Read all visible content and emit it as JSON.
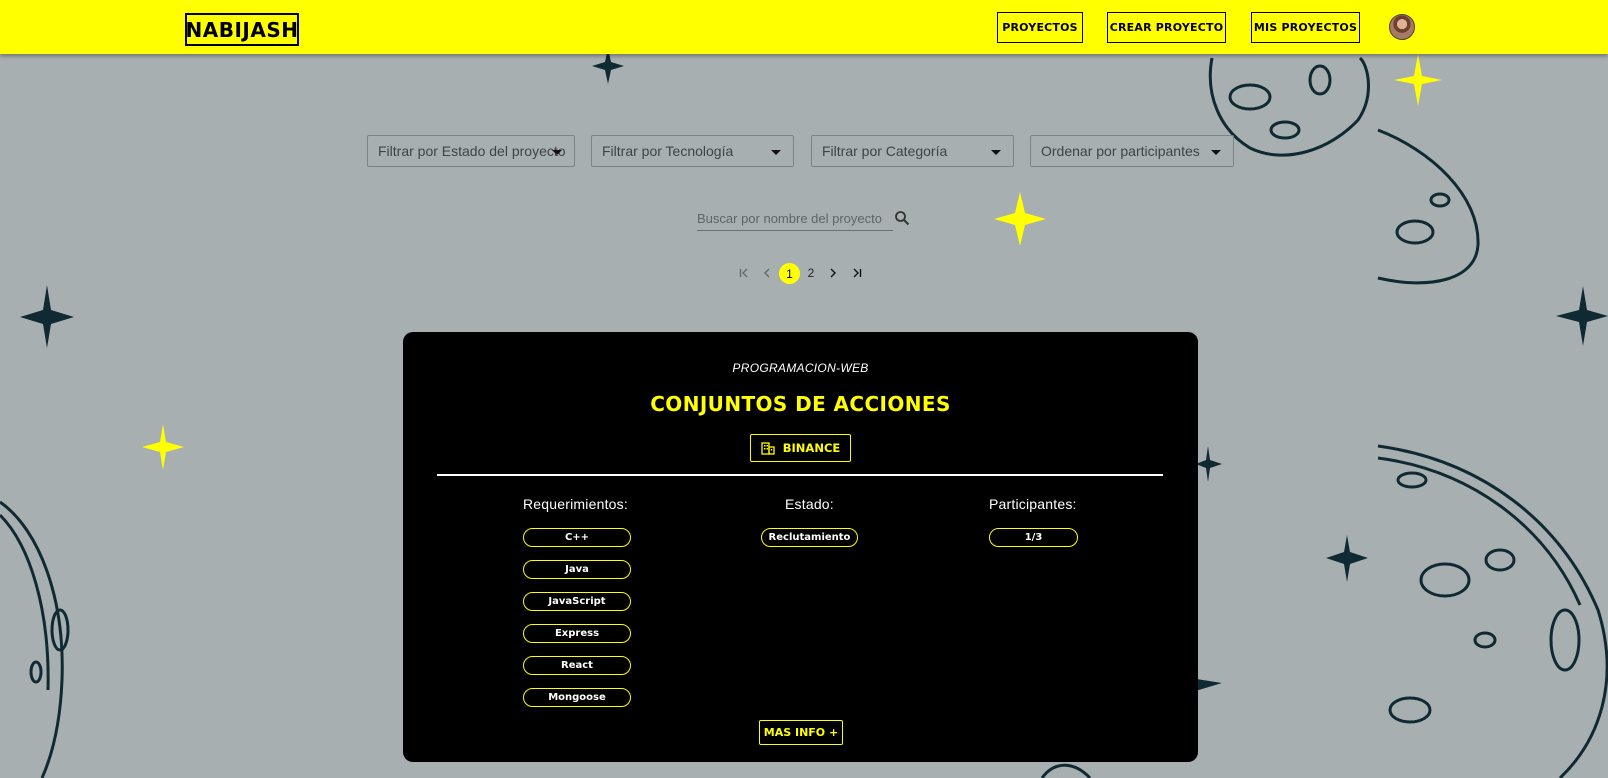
{
  "colors": {
    "accent": "#ffff00",
    "background": "#a8afb0",
    "card": "#000000",
    "ink": "#0f2a33"
  },
  "header": {
    "logo": "NABIJASH",
    "nav": [
      "PROYECTOS",
      "CREAR PROYECTO",
      "MIS PROYECTOS"
    ],
    "avatar_icon": "user-avatar"
  },
  "filters": {
    "status": "Filtrar por Estado del proyecto",
    "technology": "Filtrar por Tecnología",
    "category": "Filtrar por Categoría",
    "order": "Ordenar por participantes"
  },
  "search": {
    "placeholder": "Buscar por nombre del proyecto",
    "icon": "search-icon"
  },
  "pagination": {
    "first_icon": "first-page-icon",
    "prev_icon": "prev-page-icon",
    "pages": [
      "1",
      "2"
    ],
    "current": "1",
    "next_icon": "next-page-icon",
    "last_icon": "last-page-icon"
  },
  "project": {
    "category": "PROGRAMACION-WEB",
    "title": "CONJUNTOS DE ACCIONES",
    "company": "BINANCE",
    "company_icon": "building-icon",
    "requirements_label": "Requerimientos:",
    "requirements": [
      "C++",
      "Java",
      "JavaScript",
      "Express",
      "React",
      "Mongoose"
    ],
    "status_label": "Estado:",
    "status": "Reclutamiento",
    "participants_label": "Participantes:",
    "participants": "1/3",
    "more_button": "MAS INFO +"
  }
}
